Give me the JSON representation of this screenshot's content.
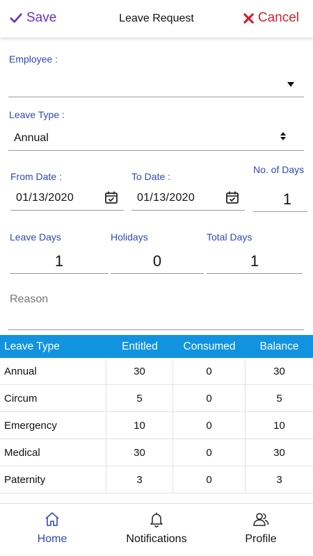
{
  "header": {
    "save_label": "Save",
    "title": "Leave Request",
    "cancel_label": "Cancel"
  },
  "form": {
    "employee_label": "Employee :",
    "employee_value": "",
    "leave_type_label": "Leave Type :",
    "leave_type_value": "Annual",
    "from_date_label": "From Date :",
    "from_date_value": "01/13/2020",
    "to_date_label": "To Date :",
    "to_date_value": "01/13/2020",
    "no_of_days_label": "No. of Days",
    "no_of_days_value": "1",
    "leave_days_label": "Leave Days",
    "leave_days_value": "1",
    "holidays_label": "Holidays",
    "holidays_value": "0",
    "total_days_label": "Total Days",
    "total_days_value": "1",
    "reason_placeholder": "Reason"
  },
  "balance_table": {
    "headers": [
      "Leave Type",
      "Entitled",
      "Consumed",
      "Balance"
    ],
    "rows": [
      [
        "Annual",
        "30",
        "0",
        "30"
      ],
      [
        "Circum",
        "5",
        "0",
        "5"
      ],
      [
        "Emergency",
        "10",
        "0",
        "10"
      ],
      [
        "Medical",
        "30",
        "0",
        "30"
      ],
      [
        "Paternity",
        "3",
        "0",
        "3"
      ]
    ]
  },
  "bottom_nav": {
    "items": [
      {
        "label": "Home",
        "icon": "home-icon",
        "active": true
      },
      {
        "label": "Notifications",
        "icon": "bell-icon",
        "active": false
      },
      {
        "label": "Profile",
        "icon": "users-icon",
        "active": false
      }
    ]
  },
  "colors": {
    "accent_purple": "#6a2fc0",
    "cancel_red": "#d32030",
    "label_blue": "#2f48b8",
    "table_header_blue": "#1193e0"
  }
}
